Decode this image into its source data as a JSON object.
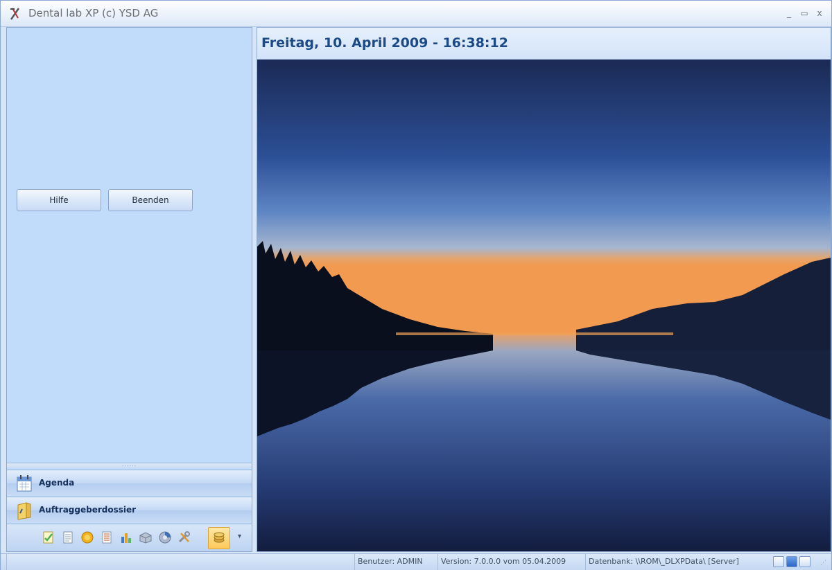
{
  "window": {
    "title": "Dental lab XP (c) YSD AG",
    "controls": {
      "minimize": "_",
      "maximize": "▭",
      "close": "x"
    }
  },
  "left_panel": {
    "buttons": {
      "help": "Hilfe",
      "exit": "Beenden"
    },
    "splitter_grip": "......",
    "nav_items": [
      {
        "label": "Agenda",
        "icon": "calendar-icon"
      },
      {
        "label": "Auftraggeberdossier",
        "icon": "folder-dossier-icon"
      }
    ],
    "toolbar_icons": [
      "checklist-icon",
      "document-icon",
      "coins-icon",
      "list-icon",
      "chart-icon",
      "box-icon",
      "disc-icon",
      "tools-icon",
      "coin-stack-icon"
    ],
    "toolbar_active_icon": "coin-stack-icon",
    "toolbar_more": "▾"
  },
  "main": {
    "datetime": "Freitag, 10. April 2009 - 16:38:12",
    "image_subject": "lake-at-dusk"
  },
  "statusbar": {
    "user": "Benutzer: ADMIN",
    "version": "Version: 7.0.0.0 vom 05.04.2009",
    "database": "Datenbank: \\\\ROM\\_DLXPData\\ [Server]",
    "icons": [
      "view-normal-icon",
      "play-icon",
      "zoom-icon"
    ]
  },
  "colors": {
    "accent": "#1b4a86",
    "panel": "#c1dbfa",
    "sky_top": "#1c2a55",
    "sunset": "#e9a05a"
  }
}
